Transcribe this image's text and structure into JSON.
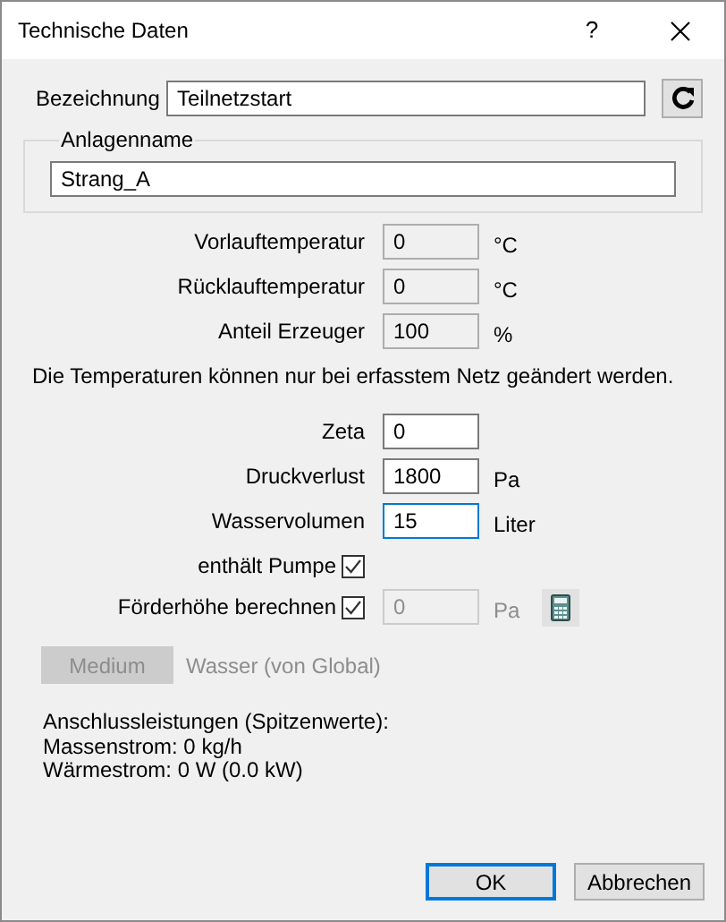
{
  "window": {
    "title": "Technische Daten",
    "help": "?"
  },
  "bezeichnung": {
    "label": "Bezeichnung",
    "value": "Teilnetzstart"
  },
  "anlagenname": {
    "legend": "Anlagenname",
    "value": "Strang_A"
  },
  "readonly_fields": [
    {
      "label": "Vorlauftemperatur",
      "value": "0",
      "unit": "°C"
    },
    {
      "label": "Rücklauftemperatur",
      "value": "0",
      "unit": "°C"
    },
    {
      "label": "Anteil Erzeuger",
      "value": "100",
      "unit": "%"
    }
  ],
  "note": "Die Temperaturen können nur bei erfasstem Netz geändert werden.",
  "fields": [
    {
      "label": "Zeta",
      "value": "0",
      "focused": false
    },
    {
      "label": "Druckverlust",
      "value": "1800",
      "unit": "Pa",
      "focused": false
    },
    {
      "label": "Wasservolumen",
      "value": "15",
      "unit": "Liter",
      "focused": true
    }
  ],
  "checks": [
    {
      "label": "enthält Pumpe",
      "checked": true
    },
    {
      "label": "Förderhöhe berechnen",
      "checked": true,
      "value": "0",
      "unit": "Pa",
      "disabled": true
    }
  ],
  "medium": {
    "button": "Medium",
    "disabled": true,
    "text": "Wasser (von Global)"
  },
  "summary": [
    "Anschlussleistungen (Spitzenwerte):",
    "Massenstrom: 0 kg/h",
    "Wärmestrom: 0 W (0.0 kW)"
  ],
  "buttons": [
    {
      "label": "OK",
      "default": true
    },
    {
      "label": "Abbrechen",
      "default": false
    }
  ]
}
